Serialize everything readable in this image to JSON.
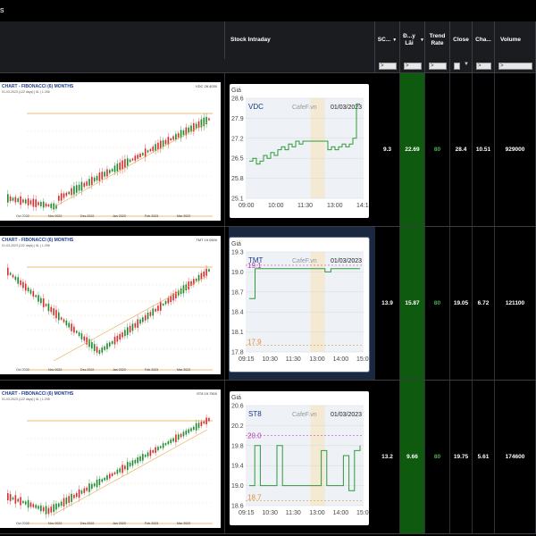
{
  "window": {
    "title": "s"
  },
  "columns": {
    "stock_intraday": "Stock Intraday",
    "score": "SC...",
    "profit": "Đ...y Lãi",
    "trend_rate": "Trend Rate",
    "close": "Close",
    "change": "Cha...",
    "volume": "Volume"
  },
  "filters": {
    "gt": ">",
    "eq": "="
  },
  "rows": [
    {
      "ticker": "VDC",
      "fibo_title": "CHART - FIBONACCI (6) MONTHS",
      "fibo_tag": "VDC 28.4030",
      "fibo_sub": "01-03-2023 (122 days) | 6L | 1.256",
      "fibo_months": [
        "Oct 2022",
        "Nov 2022",
        "Dec 2022",
        "Jan 2023",
        "Feb 2023",
        "Mar 2023"
      ],
      "intra_label": "Giá",
      "intra_source": "CafeF.vn",
      "intra_date": "01/03/2023",
      "intra_y": [
        "28.6",
        "27.9",
        "27.2",
        "26.5",
        "25.8",
        "25.1"
      ],
      "intra_x": [
        "09:00",
        "10:00",
        "11:30",
        "13:00",
        "14:15"
      ],
      "intra_series": [
        26.4,
        26.5,
        26.3,
        26.4,
        26.6,
        26.5,
        26.7,
        26.6,
        26.8,
        26.9,
        26.8,
        27.0,
        26.9,
        27.1,
        27.0,
        27.1,
        27.1,
        27.1,
        27.1,
        27.1,
        27.1,
        27.1,
        26.8,
        26.9,
        26.8,
        26.9,
        27.0,
        26.9,
        27.0,
        27.2,
        28.4,
        28.4
      ],
      "score": "9.3",
      "profit": "22.69",
      "trend_rate": "80",
      "close": "28.4",
      "change": "10.51",
      "volume": "929000"
    },
    {
      "ticker": "TMT",
      "fibo_title": "CHART - FIBONACCI (6) MONTHS",
      "fibo_tag": "TMT 19.0500",
      "fibo_sub": "01-03-2023 (122 days) | 6L | 1.296",
      "fibo_months": [
        "Oct 2022",
        "Nov 2022",
        "Dec 2022",
        "Jan 2023",
        "Feb 2023",
        "Mar 2023"
      ],
      "intra_label": "Giá",
      "intra_source": "CafeF.vn",
      "intra_date": "01/03/2023",
      "intra_y": [
        "19.3",
        "19.0",
        "18.7",
        "18.4",
        "18.1",
        "17.8"
      ],
      "intra_x": [
        "09:15",
        "10:30",
        "11:30",
        "13:00",
        "14:00",
        "15:00"
      ],
      "intra_hi": "19.1",
      "intra_lo": "17.9",
      "intra_series": [
        18.6,
        19.05,
        19.05,
        19.05,
        19.05,
        19.05,
        19.05,
        19.05,
        19.05,
        19.05,
        19.05,
        19.05,
        19.05,
        19.0,
        19.05,
        19.05,
        19.05,
        19.05,
        19.05,
        19.05
      ],
      "score": "13.9",
      "profit": "15.87",
      "trend_rate": "80",
      "close": "19.05",
      "change": "6.72",
      "volume": "121100"
    },
    {
      "ticker": "ST8",
      "fibo_title": "CHART - FIBONACCI (6) MONTHS",
      "fibo_tag": "ST8 19.7500",
      "fibo_sub": "01-03-2023 (122 days) | 6L | 1.295",
      "fibo_months": [
        "Oct 2022",
        "Nov 2022",
        "Dec 2022",
        "Jan 2023",
        "Feb 2023",
        "Mar 2023"
      ],
      "intra_label": "Giá",
      "intra_source": "CafeF.vn",
      "intra_date": "01/03/2023",
      "intra_y": [
        "20.6",
        "20.2",
        "19.8",
        "19.4",
        "19.0",
        "18.6"
      ],
      "intra_x": [
        "09:15",
        "10:30",
        "11:30",
        "13:00",
        "14:00",
        "15:00"
      ],
      "intra_hi": "20.0",
      "intra_lo": "18.7",
      "intra_series": [
        19.0,
        19.8,
        19.0,
        19.0,
        19.0,
        19.8,
        19.0,
        19.0,
        19.0,
        19.0,
        19.0,
        19.0,
        19.0,
        19.7,
        19.0,
        19.0,
        19.0,
        19.6,
        18.9,
        19.7,
        19.8
      ],
      "score": "13.2",
      "profit": "9.66",
      "trend_rate": "80",
      "close": "19.75",
      "change": "5.61",
      "volume": "174600"
    }
  ]
}
